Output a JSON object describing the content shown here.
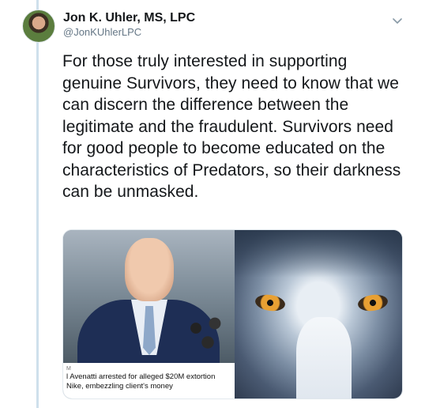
{
  "author": {
    "display_name": "Jon K. Uhler, MS, LPC",
    "handle": "@JonKUhlerLPC"
  },
  "tweet": {
    "text": "For those truly interested in supporting genuine Survivors, they need to know that we can discern the difference between the legitimate and the fraudulent. Survivors need for good people to become educated on the characteristics of Predators, so their darkness can be unmasked."
  },
  "media": {
    "left_caption_tag": "M",
    "left_caption_line1": "l Avenatti arrested for alleged $20M extortion",
    "left_caption_line2": "Nike, embezzling client's money",
    "right_image": "wolf-eyes-photo"
  },
  "icons": {
    "menu": "chevron-down-icon",
    "avatar": "profile-photo"
  },
  "colors": {
    "text_primary": "#14171a",
    "text_secondary": "#657786",
    "thread_line": "#cfe0ec",
    "border": "#e1e8ed"
  }
}
